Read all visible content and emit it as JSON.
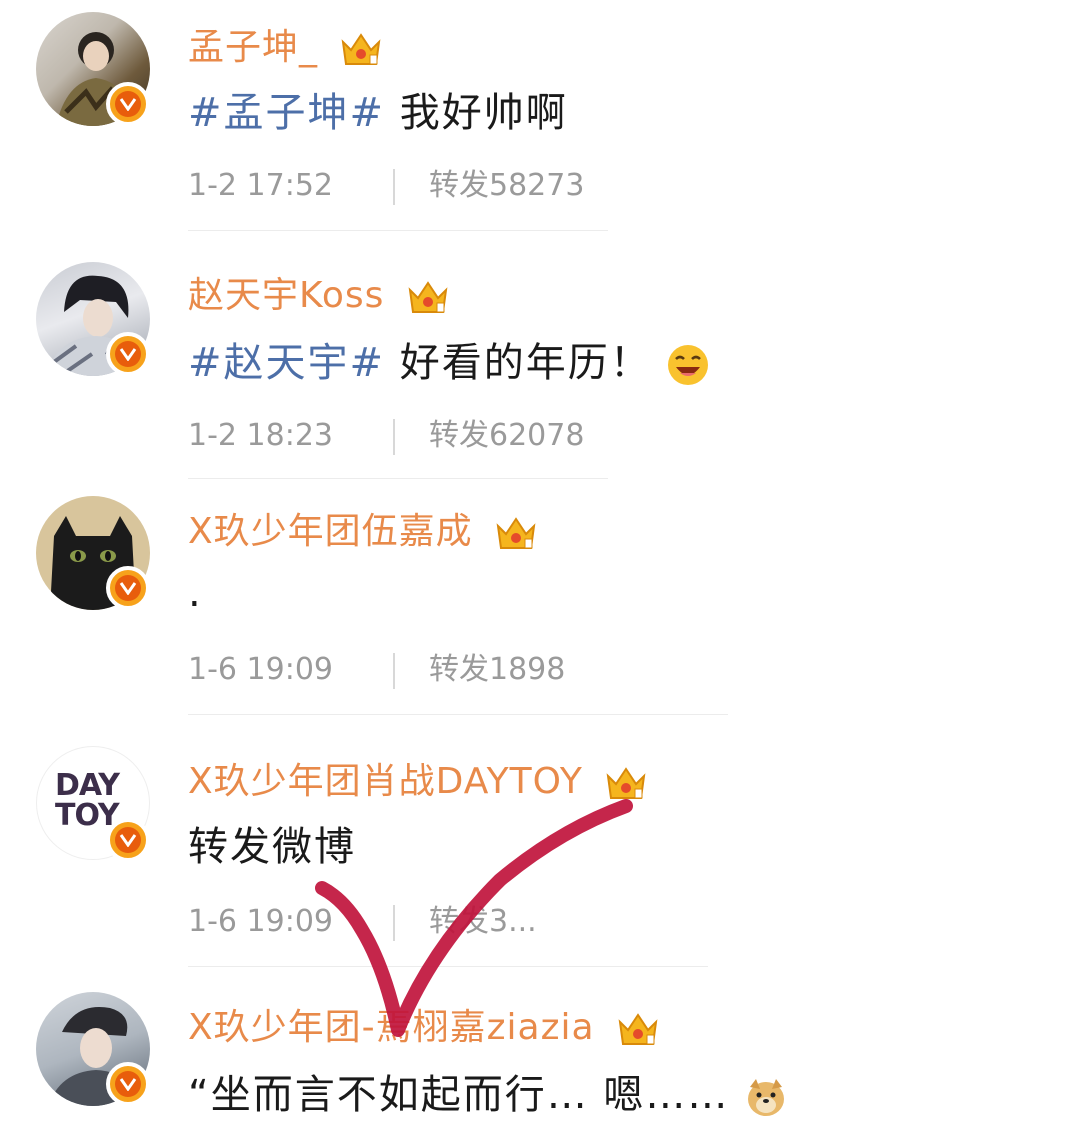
{
  "posts": [
    {
      "username": "孟子坤_",
      "hashtag": "#孟子坤#",
      "text": " 我好帅啊",
      "time": "1-2  17:52",
      "repost": "转发58273"
    },
    {
      "username": "赵天宇Koss",
      "hashtag": "#赵天宇#",
      "text": " 好看的年历！",
      "time": "1-2  18:23",
      "repost": "转发62078"
    },
    {
      "username": "X玖少年团伍嘉成",
      "hashtag": "",
      "text": ".",
      "time": "1-6  19:09",
      "repost": "转发1898"
    },
    {
      "username": "X玖少年团肖战DAYTOY",
      "avatar_text_1": "DAY",
      "avatar_text_2": "TOY",
      "hashtag": "",
      "text": "转发微博",
      "time": "1-6  19:09",
      "repost": "转发3..."
    },
    {
      "username": "X玖少年团-焉栩嘉ziazia",
      "hashtag": "",
      "text": "“坐而言不如起而行… 嗯……",
      "time": "",
      "repost": ""
    }
  ],
  "icons": {
    "crown": "crown-icon",
    "verified": "verified-v-icon",
    "laugh": "laughing-emoji-icon",
    "doge": "doge-emoji-icon"
  },
  "colors": {
    "username": "#e88a4a",
    "hashtag": "#4d6fa8",
    "meta": "#9a9a9a",
    "check": "#c0143c",
    "verified": "#f7a21b"
  }
}
